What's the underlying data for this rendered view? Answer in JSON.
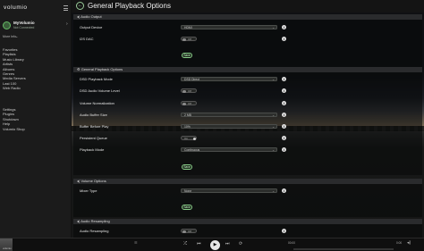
{
  "app": {
    "logo": "volumio"
  },
  "device": {
    "name": "MyVolumio",
    "status": "Not Connected",
    "more_info": "More Info"
  },
  "nav": {
    "group1": [
      "Favorites",
      "Playlists",
      "Music Library",
      "Artists",
      "Albums",
      "Genres",
      "Media Servers",
      "Last 100",
      "Web Radio"
    ],
    "group2": [
      "Settings",
      "Plugins",
      "Shutdown",
      "Help",
      "Volumio Shop"
    ]
  },
  "page": {
    "title": "General Playback Options"
  },
  "sections": {
    "audio_output": {
      "title": "Audio Output",
      "output_device_label": "Output Device",
      "output_device_value": "HDMI",
      "i2s_dac_label": "I2S DAC",
      "i2s_dac_value": "Off",
      "save": "Save"
    },
    "general": {
      "title": "General Playback Options",
      "dsd_mode_label": "DSD Playback Mode",
      "dsd_mode_value": "DSD Direct",
      "dsd_vol_label": "DSD Audio Volume Level",
      "dsd_vol_value": "Off",
      "vol_norm_label": "Volume Normalization",
      "vol_norm_value": "Off",
      "buffer_size_label": "Audio Buffer Size",
      "buffer_size_value": "2 MB",
      "buffer_before_label": "Buffer Before Play",
      "buffer_before_value": "10%",
      "persistent_queue_label": "Persistent Queue",
      "persistent_queue_value": "On",
      "playback_mode_label": "Playback Mode",
      "playback_mode_value": "Continuous",
      "save": "Save"
    },
    "volume": {
      "title": "Volume Options",
      "mixer_type_label": "Mixer Type",
      "mixer_type_value": "None",
      "save": "Save"
    },
    "resampling": {
      "title": "Audio Resampling",
      "audio_resampling_label": "Audio Resampling",
      "audio_resampling_value": "Off"
    }
  },
  "player": {
    "track": "volumio",
    "time_elapsed": "00:00",
    "time_total": "0:00",
    "progress_percent": 0
  },
  "icons": {
    "back": "arrow-left-icon",
    "menu": "hamburger-icon",
    "info": "info-icon",
    "play": "play-icon"
  }
}
